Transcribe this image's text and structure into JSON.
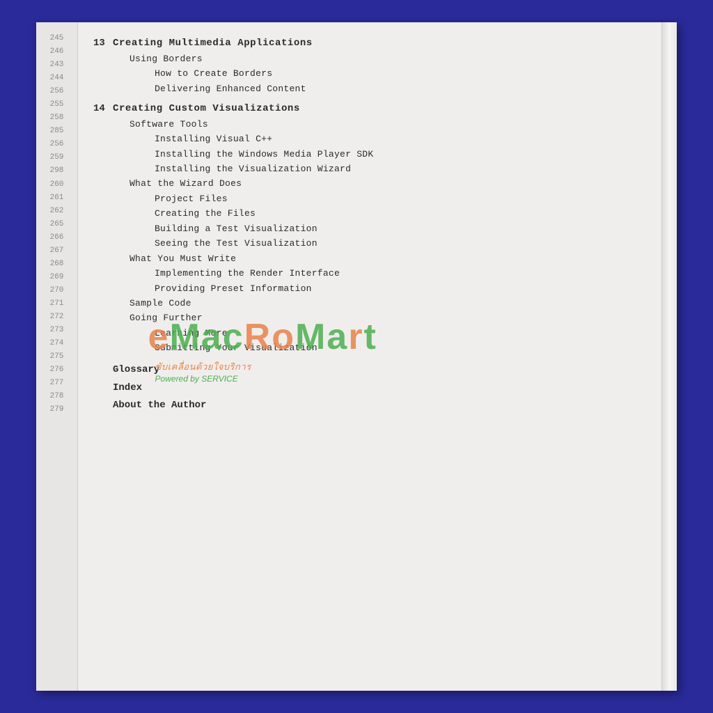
{
  "page": {
    "background_color": "#2a2a9a",
    "page_numbers": [
      "245",
      "246",
      "243",
      "244",
      "256",
      "255",
      "258",
      "285",
      "256",
      "259",
      "298",
      "260",
      "261",
      "262",
      "265",
      "266",
      "267",
      "268",
      "269",
      "270",
      "271",
      "272",
      "273",
      "274",
      "275",
      "276",
      "277",
      "278",
      "279"
    ],
    "watermark": {
      "brand": "eMacRoMart",
      "letters": [
        "e",
        "M",
        "a",
        "c",
        "R",
        "o",
        "M",
        "a",
        "r",
        "t"
      ],
      "tagline": "ขับเคลื่อนด้วยใจบริการ",
      "powered": "Powered by SERVICE"
    }
  },
  "toc": {
    "chapters": [
      {
        "num": "13",
        "title": "Creating  Multimedia  Applications",
        "sections": [
          {
            "level": 1,
            "text": "Using  Borders",
            "subsections": [
              {
                "text": "How  to  Create  Borders"
              },
              {
                "text": "Delivering  Enhanced  Content"
              }
            ]
          }
        ]
      },
      {
        "num": "14",
        "title": "Creating  Custom  Visualizations",
        "sections": [
          {
            "level": 1,
            "text": "Software   Tools",
            "subsections": [
              {
                "text": "Installing  Visual  C++"
              },
              {
                "text": "Installing  the  Windows  Media  Player  SDK"
              },
              {
                "text": "Installing  the  Visualization  Wizard"
              }
            ]
          },
          {
            "level": 1,
            "text": "What  the  Wizard  Does",
            "subsections": [
              {
                "text": "Project  Files"
              },
              {
                "text": "Creating  the  Files"
              },
              {
                "text": "Building  a  Test  Visualization"
              },
              {
                "text": "Seeing  the  Test  Visualization"
              }
            ]
          },
          {
            "level": 1,
            "text": "What  You  Must  Write",
            "subsections": [
              {
                "text": "Implementing  the  Render  Interface"
              },
              {
                "text": "Providing  Preset  Information"
              }
            ]
          },
          {
            "level": 1,
            "text": "Sample  Code",
            "subsections": []
          },
          {
            "level": 1,
            "text": "Going  Further",
            "subsections": [
              {
                "text": "Learning   More"
              },
              {
                "text": "Submitting  Your  Visualization"
              }
            ]
          }
        ]
      }
    ],
    "bottom_entries": [
      "Glossary",
      "Index",
      "About  the  Author"
    ]
  }
}
